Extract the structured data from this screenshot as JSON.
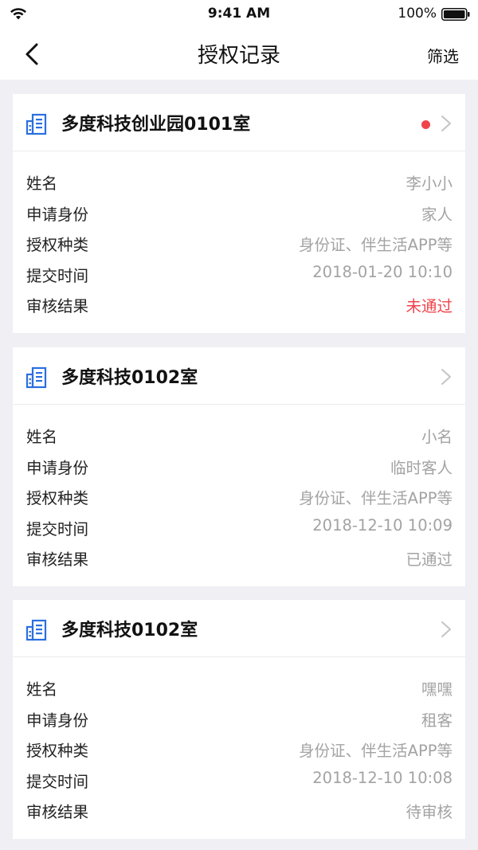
{
  "status_bar": {
    "time": "9:41 AM",
    "battery": "100%"
  },
  "nav": {
    "title": "授权记录",
    "filter_label": "筛选"
  },
  "field_labels": [
    "姓名",
    "申请身份",
    "授权种类",
    "提交时间",
    "审核结果"
  ],
  "records": [
    {
      "title": "多度科技创业园0101室",
      "unread": true,
      "values": [
        "李小小",
        "家人",
        "身份证、伴生活APP等",
        "2018-01-20 10:10",
        "未通过"
      ],
      "result_status": "rejected"
    },
    {
      "title": "多度科技0102室",
      "unread": false,
      "values": [
        "小名",
        "临时客人",
        "身份证、伴生活APP等",
        "2018-12-10 10:09",
        "已通过"
      ],
      "result_status": "approved"
    },
    {
      "title": "多度科技0102室",
      "unread": false,
      "values": [
        "嘿嘿",
        "租客",
        "身份证、伴生活APP等",
        "2018-12-10 10:08",
        "待审核"
      ],
      "result_status": "pending"
    }
  ],
  "colors": {
    "background": "#efeff4",
    "accent_blue": "#2a6fe0",
    "rejected_red": "#f0444c",
    "value_gray": "#a3a3a3"
  }
}
